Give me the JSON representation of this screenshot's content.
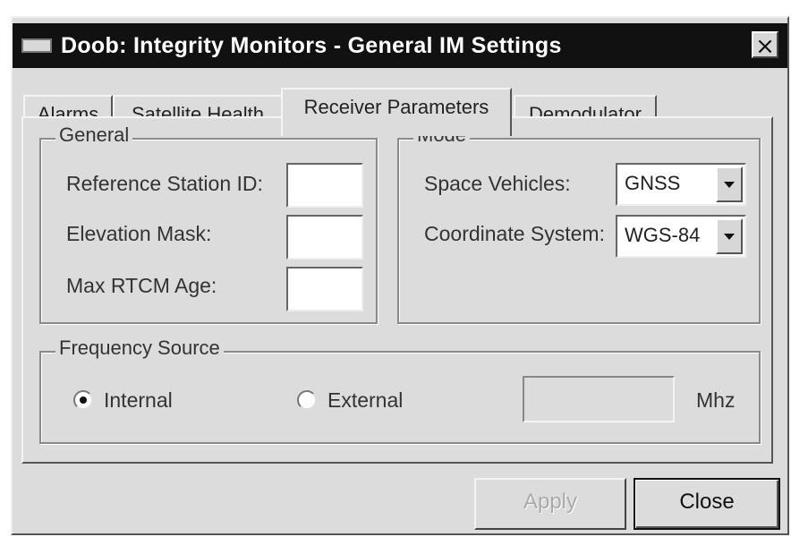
{
  "window": {
    "title": "Doob: Integrity Monitors - General IM Settings",
    "close_glyph": "×"
  },
  "tabs": [
    {
      "label": "Alarms"
    },
    {
      "label": "Satellite Health"
    },
    {
      "label": "Receiver Parameters",
      "active": true
    },
    {
      "label": "Demodulator"
    }
  ],
  "general": {
    "legend": "General",
    "reference_station_id": {
      "label": "Reference Station ID:",
      "value": ""
    },
    "elevation_mask": {
      "label": "Elevation Mask:",
      "value": ""
    },
    "max_rtcm_age": {
      "label": "Max RTCM Age:",
      "value": ""
    }
  },
  "mode": {
    "legend": "Mode",
    "space_vehicles": {
      "label": "Space Vehicles:",
      "selected": "GNSS"
    },
    "coordinate_system": {
      "label": "Coordinate System:",
      "selected": "WGS-84"
    }
  },
  "frequency_source": {
    "legend": "Frequency Source",
    "internal_label": "Internal",
    "external_label": "External",
    "selected": "Internal",
    "frequency_value": "",
    "unit": "Mhz"
  },
  "buttons": {
    "apply": "Apply",
    "close": "Close"
  },
  "icons": {
    "window_icon": "window-menu-icon",
    "close_icon": "close-icon",
    "dropdown_icon": "chevron-down-icon"
  }
}
